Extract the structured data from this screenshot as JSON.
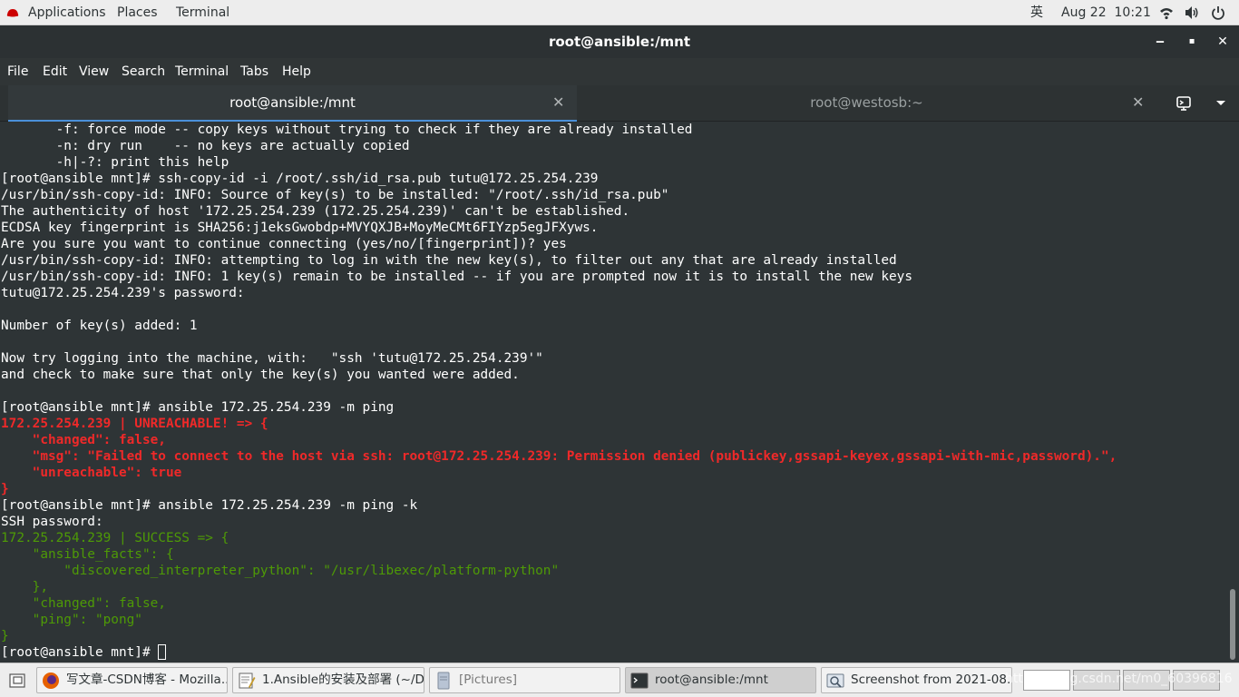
{
  "topbar": {
    "applications": "Applications",
    "places": "Places",
    "terminal": "Terminal",
    "input_method": "英",
    "clock": "Aug 22  10:21",
    "icons": [
      "wifi-icon",
      "volume-icon",
      "power-icon"
    ]
  },
  "window": {
    "title": "root@ansible:/mnt",
    "controls": {
      "minimize": "‒",
      "maximize": "▪",
      "close": "✕"
    }
  },
  "menubar": [
    "File",
    "Edit",
    "View",
    "Search",
    "Terminal",
    "Tabs",
    "Help"
  ],
  "tabs": [
    {
      "label": "root@ansible:/mnt",
      "active": true
    },
    {
      "label": "root@westosb:~",
      "active": false
    }
  ],
  "terminal": {
    "lines": [
      {
        "t": "       -f: force mode -- copy keys without trying to check if they are already installed",
        "c": "w"
      },
      {
        "t": "       -n: dry run    -- no keys are actually copied",
        "c": "w"
      },
      {
        "t": "       -h|-?: print this help",
        "c": "w"
      },
      {
        "t": "[root@ansible mnt]# ssh-copy-id -i /root/.ssh/id_rsa.pub tutu@172.25.254.239",
        "c": "w"
      },
      {
        "t": "/usr/bin/ssh-copy-id: INFO: Source of key(s) to be installed: \"/root/.ssh/id_rsa.pub\"",
        "c": "w"
      },
      {
        "t": "The authenticity of host '172.25.254.239 (172.25.254.239)' can't be established.",
        "c": "w"
      },
      {
        "t": "ECDSA key fingerprint is SHA256:j1eksGwobdp+MVYQXJB+MoyMeCMt6FIYzp5egJFXyws.",
        "c": "w"
      },
      {
        "t": "Are you sure you want to continue connecting (yes/no/[fingerprint])? yes",
        "c": "w"
      },
      {
        "t": "/usr/bin/ssh-copy-id: INFO: attempting to log in with the new key(s), to filter out any that are already installed",
        "c": "w"
      },
      {
        "t": "/usr/bin/ssh-copy-id: INFO: 1 key(s) remain to be installed -- if you are prompted now it is to install the new keys",
        "c": "w"
      },
      {
        "t": "tutu@172.25.254.239's password: ",
        "c": "w"
      },
      {
        "t": "",
        "c": "w"
      },
      {
        "t": "Number of key(s) added: 1",
        "c": "w"
      },
      {
        "t": "",
        "c": "w"
      },
      {
        "t": "Now try logging into the machine, with:   \"ssh 'tutu@172.25.254.239'\"",
        "c": "w"
      },
      {
        "t": "and check to make sure that only the key(s) you wanted were added.",
        "c": "w"
      },
      {
        "t": "",
        "c": "w"
      },
      {
        "t": "[root@ansible mnt]# ansible 172.25.254.239 -m ping",
        "c": "w"
      },
      {
        "t": "172.25.254.239 | UNREACHABLE! => {",
        "c": "r"
      },
      {
        "t": "    \"changed\": false,",
        "c": "r"
      },
      {
        "t": "    \"msg\": \"Failed to connect to the host via ssh: root@172.25.254.239: Permission denied (publickey,gssapi-keyex,gssapi-with-mic,password).\",",
        "c": "r"
      },
      {
        "t": "    \"unreachable\": true",
        "c": "r"
      },
      {
        "t": "}",
        "c": "r"
      },
      {
        "t": "[root@ansible mnt]# ansible 172.25.254.239 -m ping -k",
        "c": "w"
      },
      {
        "t": "SSH password: ",
        "c": "w"
      },
      {
        "t": "172.25.254.239 | SUCCESS => {",
        "c": "g"
      },
      {
        "t": "    \"ansible_facts\": {",
        "c": "g"
      },
      {
        "t": "        \"discovered_interpreter_python\": \"/usr/libexec/platform-python\"",
        "c": "g"
      },
      {
        "t": "    },",
        "c": "g"
      },
      {
        "t": "    \"changed\": false,",
        "c": "g"
      },
      {
        "t": "    \"ping\": \"pong\"",
        "c": "g"
      },
      {
        "t": "}",
        "c": "g"
      }
    ],
    "prompt": "[root@ansible mnt]# "
  },
  "taskbar": {
    "items": [
      {
        "label": "写文章-CSDN博客 - Mozilla...",
        "icon": "firefox-icon",
        "active": false
      },
      {
        "label": "1.Ansible的安装及部署 (~/D...",
        "icon": "text-editor-icon",
        "active": false
      },
      {
        "label": "[Pictures]",
        "icon": "file-manager-icon",
        "active": false
      },
      {
        "label": "root@ansible:/mnt",
        "icon": "terminal-icon",
        "active": true
      },
      {
        "label": "Screenshot from 2021-08...",
        "icon": "image-viewer-icon",
        "active": false
      }
    ],
    "watermark": "https://blog.csdn.net/m0_60396816"
  },
  "colors": {
    "terminal_bg": "#2e3436",
    "error": "#ef2929",
    "success": "#4e9a06",
    "tab_accent": "#4a90d9"
  }
}
